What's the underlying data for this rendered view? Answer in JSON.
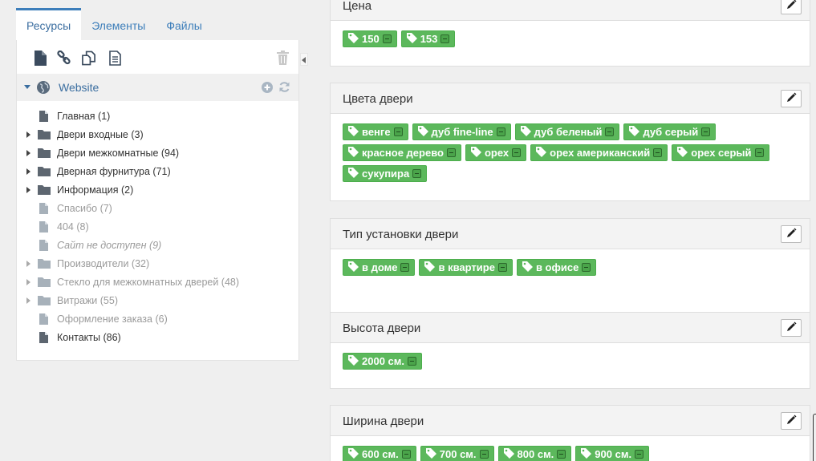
{
  "tabs": [
    {
      "label": "Ресурсы",
      "active": true
    },
    {
      "label": "Элементы",
      "active": false
    },
    {
      "label": "Файлы",
      "active": false
    }
  ],
  "toolbar_icons": [
    "new-document-icon",
    "link-icon",
    "duplicate-icon",
    "text-document-icon",
    "trash-icon"
  ],
  "tree": {
    "root": {
      "label": "Website",
      "icon": "globe-icon"
    },
    "items": [
      {
        "label": "Главная (1)",
        "type": "doc",
        "style": "normal"
      },
      {
        "label": "Двери входные (3)",
        "type": "folder",
        "style": "normal"
      },
      {
        "label": "Двери межкомнатные (94)",
        "type": "folder",
        "style": "normal"
      },
      {
        "label": "Дверная фурнитура (71)",
        "type": "folder",
        "style": "normal"
      },
      {
        "label": "Информация (2)",
        "type": "folder",
        "style": "normal"
      },
      {
        "label": "Спасибо (7)",
        "type": "doc",
        "style": "muted"
      },
      {
        "label": "404 (8)",
        "type": "doc",
        "style": "muted"
      },
      {
        "label": "Сайт не доступен (9)",
        "type": "doc",
        "style": "muted-italic"
      },
      {
        "label": "Производители (32)",
        "type": "folder",
        "style": "muted"
      },
      {
        "label": "Стекло для межкомнатных дверей (48)",
        "type": "folder",
        "style": "muted"
      },
      {
        "label": "Витражи (55)",
        "type": "folder",
        "style": "muted"
      },
      {
        "label": "Оформление заказа (6)",
        "type": "doc",
        "style": "muted"
      },
      {
        "label": "Контакты (86)",
        "type": "doc",
        "style": "normal"
      }
    ]
  },
  "cards": [
    {
      "title": "Цена",
      "tags": [
        "150",
        "153"
      ]
    },
    {
      "title": "Цвета двери",
      "tags": [
        "венге",
        "дуб fine-line",
        "дуб беленый",
        "дуб серый",
        "красное дерево",
        "орех",
        "орех американский",
        "орех серый",
        "сукупира"
      ]
    },
    {
      "title": "Тип установки двери",
      "tags": [
        "в доме",
        "в квартире",
        "в офисе"
      ]
    },
    {
      "title": "Высота двери",
      "tags": [
        "2000 см."
      ]
    },
    {
      "title": "Ширина двери",
      "tags": [
        "600 см.",
        "700 см.",
        "800 см.",
        "900 см."
      ]
    }
  ],
  "colors": {
    "tag_bg": "#5cb85c",
    "accent": "#3d7eba"
  }
}
